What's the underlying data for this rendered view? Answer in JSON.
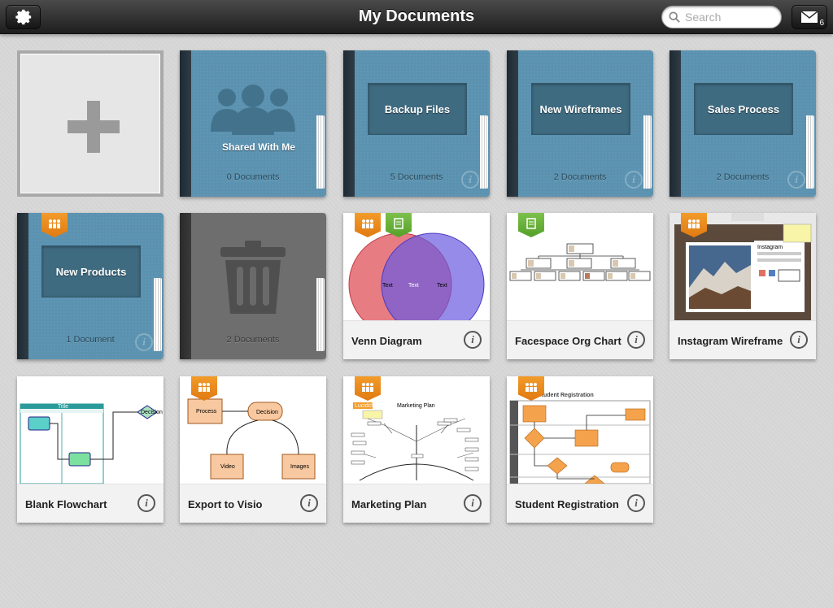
{
  "header": {
    "title": "My Documents",
    "search_placeholder": "Search",
    "mail_count": "6"
  },
  "folders": [
    {
      "name": "Shared With Me",
      "count": "0 Documents"
    },
    {
      "name": "Backup Files",
      "count": "5 Documents"
    },
    {
      "name": "New Wireframes",
      "count": "2 Documents"
    },
    {
      "name": "Sales Process",
      "count": "2 Documents"
    },
    {
      "name": "New Products",
      "count": "1 Document"
    },
    {
      "name": "",
      "count": "2 Documents"
    }
  ],
  "documents": [
    {
      "name": "Venn Diagram",
      "thumb_text": [
        "Text",
        "Text",
        "Text"
      ]
    },
    {
      "name": "Facespace Org Chart"
    },
    {
      "name": "Instagram Wireframe",
      "thumb_text": [
        "Instagram"
      ]
    },
    {
      "name": "Blank Flowchart",
      "thumb_text": [
        "Title",
        "Decision"
      ]
    },
    {
      "name": "Export to Visio",
      "thumb_text": [
        "Process",
        "Decision",
        "Video",
        "Images"
      ]
    },
    {
      "name": "Marketing Plan",
      "thumb_text": [
        "Marketing Plan",
        "Lucidchart"
      ]
    },
    {
      "name": "Student Registration",
      "thumb_text": [
        "Student Registration"
      ]
    }
  ],
  "colors": {
    "folder_blue": "#5a92b0",
    "ribbon_orange": "#f29b2a",
    "ribbon_green": "#7cc04a",
    "venn_red": "#e0505a",
    "venn_blue": "#6a5ae0",
    "flow_orange": "#f4a24c"
  },
  "icons": [
    "gear-icon",
    "search-icon",
    "mail-icon",
    "plus-icon",
    "people-icon",
    "trash-icon",
    "info-icon",
    "team-ribbon-icon",
    "document-ribbon-icon"
  ]
}
